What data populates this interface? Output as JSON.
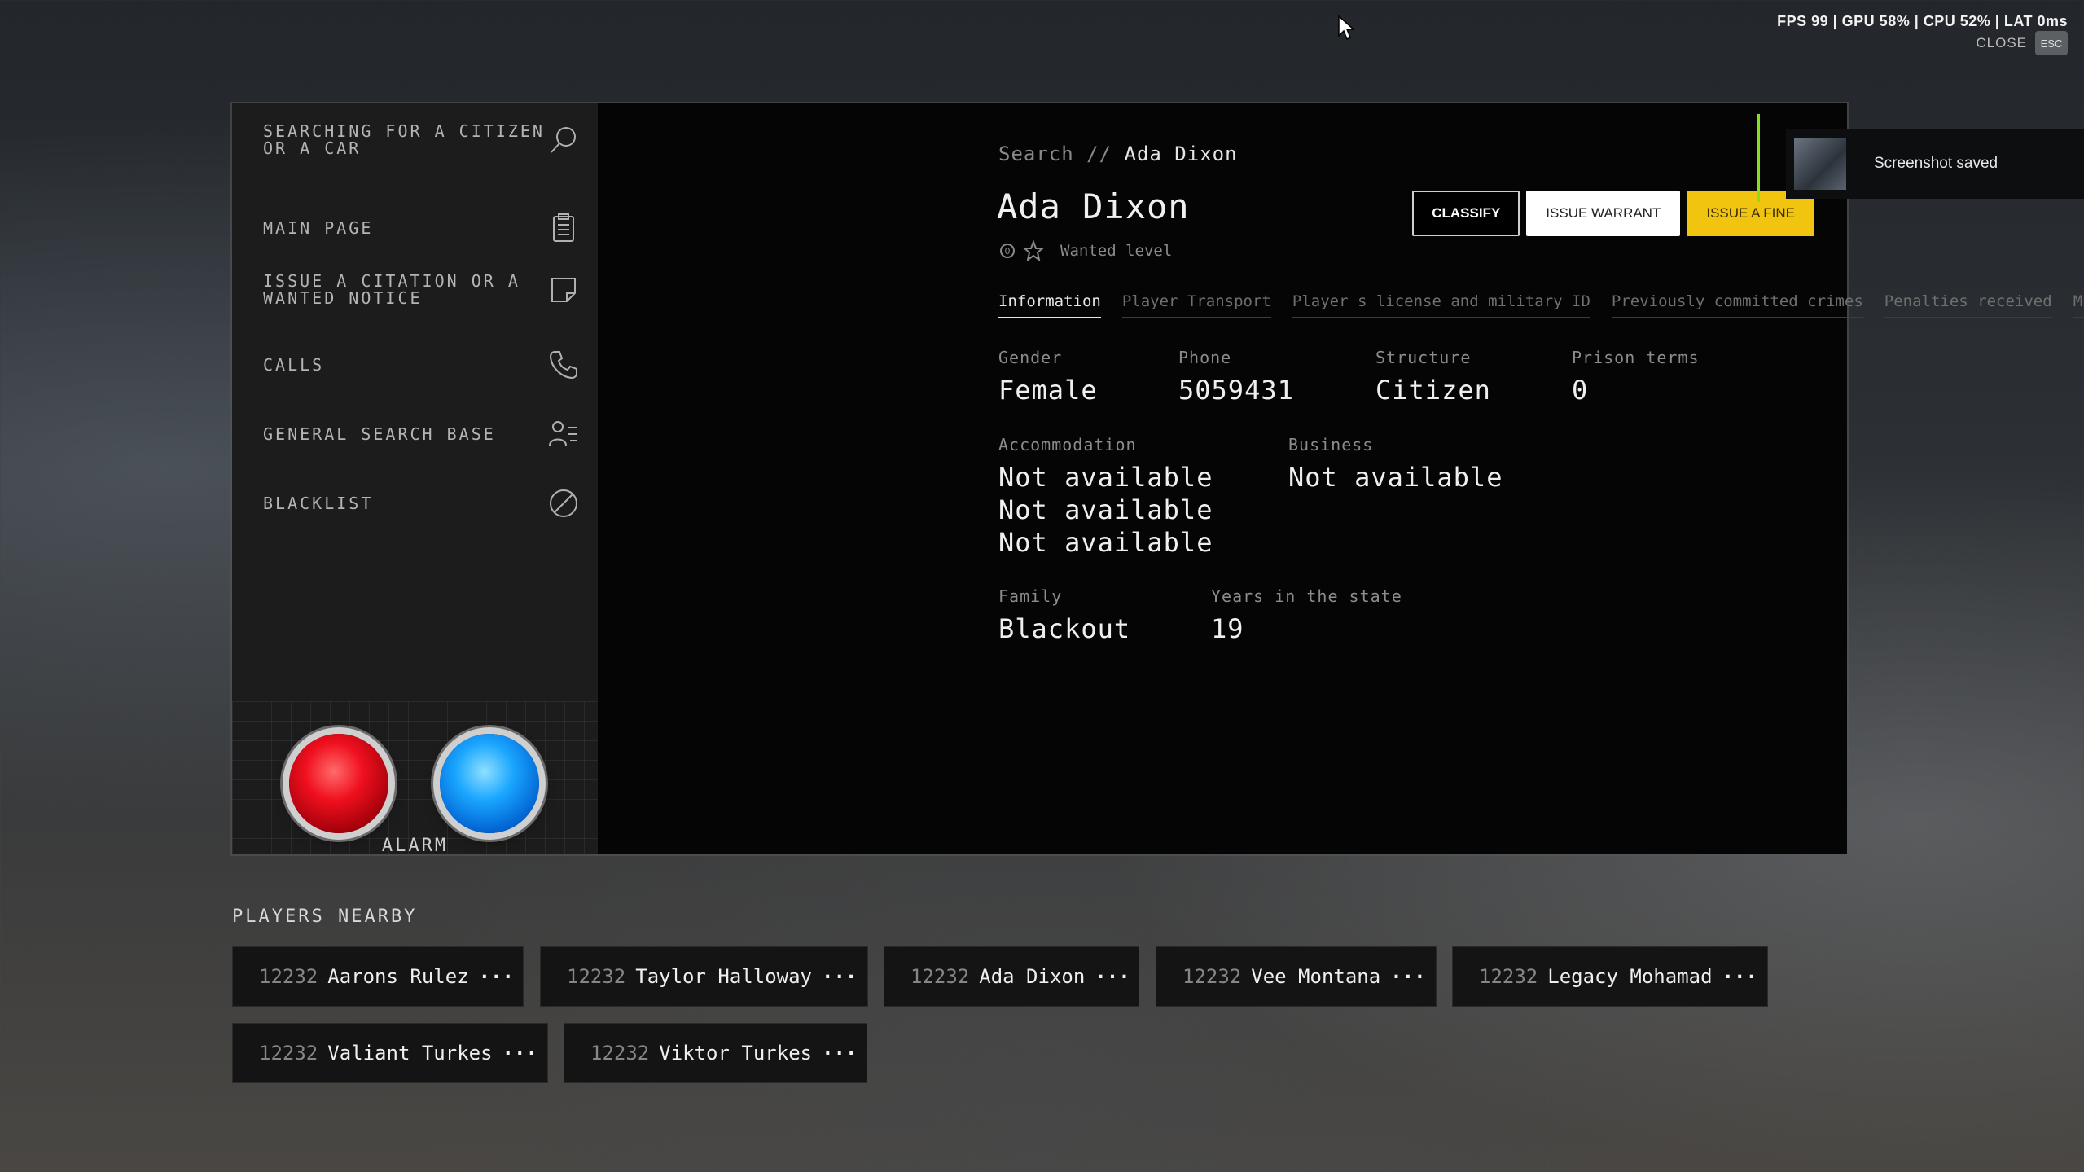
{
  "perf_overlay": {
    "text": "FPS  99  | GPU 58%  | CPU 52%  | LAT 0ms"
  },
  "close": {
    "label": "CLOSE",
    "key": "ESC"
  },
  "sidebar": {
    "items": [
      {
        "label": "SEARCHING FOR A CITIZEN\nOR A CAR",
        "icon": "search-icon"
      },
      {
        "label": "MAIN PAGE",
        "icon": "clipboard-icon"
      },
      {
        "label": "ISSUE A CITATION OR A\nWANTED NOTICE",
        "icon": "note-icon"
      },
      {
        "label": "CALLS",
        "icon": "phone-icon"
      },
      {
        "label": "GENERAL SEARCH BASE",
        "icon": "people-list-icon"
      },
      {
        "label": "BLACKLIST",
        "icon": "blocked-icon"
      }
    ],
    "alarm_label": "ALARM"
  },
  "breadcrumb": {
    "prefix": "Search // ",
    "current": "Ada Dixon"
  },
  "profile": {
    "name": "Ada Dixon",
    "wanted_label": "Wanted level",
    "wanted_value": "0"
  },
  "actions": {
    "classify": "CLASSIFY",
    "warrant": "ISSUE WARRANT",
    "fine": "ISSUE A FINE"
  },
  "toast": {
    "text": "Screenshot saved"
  },
  "tabs": [
    "Information",
    "Player Transport",
    "Player s license and military ID",
    "Previously committed crimes",
    "Penalties received",
    "Mugshots"
  ],
  "info": {
    "gender_label": "Gender",
    "gender": "Female",
    "phone_label": "Phone",
    "phone": "5059431",
    "structure_label": "Structure",
    "structure": "Citizen",
    "prison_label": "Prison terms",
    "prison": "0",
    "accommodation_label": "Accommodation",
    "accommodation": [
      "Not available",
      "Not available",
      "Not available"
    ],
    "business_label": "Business",
    "business": "Not available",
    "family_label": "Family",
    "family": "Blackout",
    "years_label": "Years in the state",
    "years": "19"
  },
  "nearby": {
    "title": "PLAYERS NEARBY",
    "more": "···",
    "players": [
      {
        "id": "12232",
        "name": "Aarons Rulez"
      },
      {
        "id": "12232",
        "name": "Taylor Halloway"
      },
      {
        "id": "12232",
        "name": "Ada Dixon"
      },
      {
        "id": "12232",
        "name": "Vee Montana"
      },
      {
        "id": "12232",
        "name": "Legacy Mohamad"
      },
      {
        "id": "12232",
        "name": "Valiant Turkes"
      },
      {
        "id": "12232",
        "name": "Viktor Turkes"
      }
    ]
  }
}
